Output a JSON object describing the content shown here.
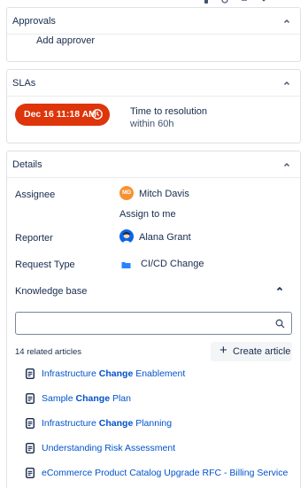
{
  "approvals": {
    "title": "Approvals",
    "add_approver": "Add approver"
  },
  "slas": {
    "title": "SLAs",
    "badge_time": "Dec 16 11:18 AM",
    "metric_name": "Time to resolution",
    "metric_target": "within 60h",
    "badge_color": "#de350b"
  },
  "details": {
    "title": "Details",
    "assignee_label": "Assignee",
    "assignee_initials": "MD",
    "assignee_name": "Mitch Davis",
    "assign_to_me": "Assign to me",
    "reporter_label": "Reporter",
    "reporter_name": "Alana Grant",
    "request_type_label": "Request Type",
    "request_type_value": "CI/CD Change",
    "knowledge_base_label": "Knowledge base"
  },
  "knowledge_base": {
    "search_value": "",
    "search_placeholder": "",
    "related_count": "14 related articles",
    "create_article": "Create article",
    "articles": [
      {
        "before": "Infrastructure ",
        "highlight": "Change",
        "after": " Enablement"
      },
      {
        "before": "Sample ",
        "highlight": "Change",
        "after": " Plan"
      },
      {
        "before": "Infrastructure ",
        "highlight": "Change",
        "after": " Planning"
      },
      {
        "before": "Understanding Risk Assessment",
        "highlight": "",
        "after": ""
      },
      {
        "before": "eCommerce Product Catalog Upgrade RFC - Billing Service",
        "highlight": "",
        "after": ""
      }
    ]
  },
  "colors": {
    "link": "#0052cc",
    "text": "#172b4d",
    "assignee_avatar": "#f79232",
    "reporter_avatar": "#0c66e4"
  }
}
